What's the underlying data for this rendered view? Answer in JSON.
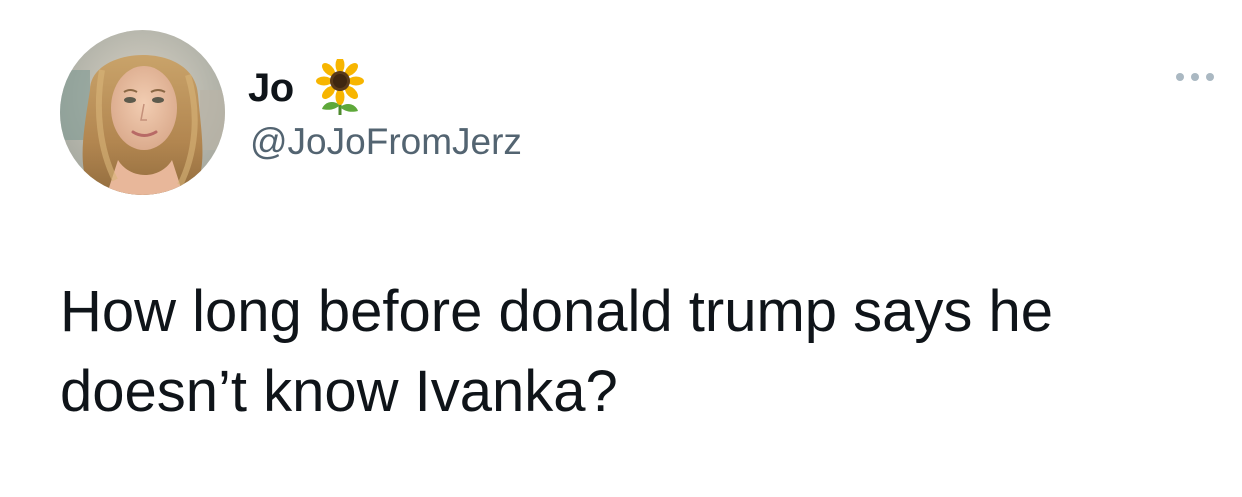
{
  "tweet": {
    "author": {
      "display_name": "Jo",
      "emoji": "sunflower-icon",
      "handle": "@JoJoFromJerz"
    },
    "text": "How long before donald trump says he doesn’t know Ivanka?"
  },
  "colors": {
    "text_primary": "#0f1419",
    "text_secondary": "#536471",
    "background": "#ffffff"
  }
}
